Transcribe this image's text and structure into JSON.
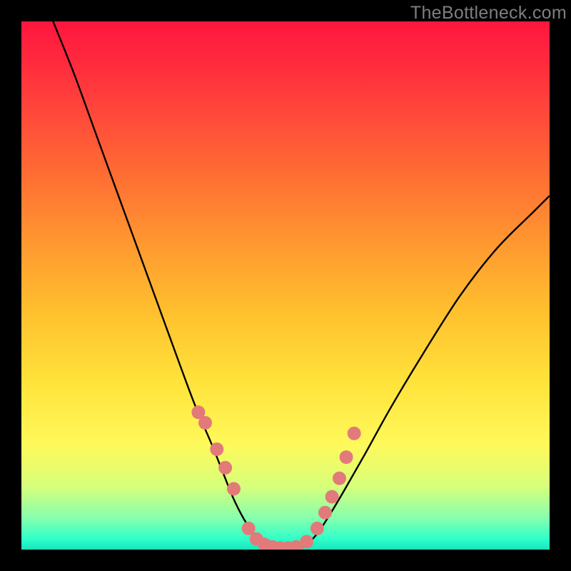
{
  "watermark": "TheBottleneck.com",
  "colors": {
    "frame": "#000000",
    "curve": "#000000",
    "marker_fill": "#e27a7a",
    "marker_stroke": "#c96060",
    "gradient_top": "#ff163e",
    "gradient_bottom": "#19e3bd"
  },
  "chart_data": {
    "type": "line",
    "title": "",
    "xlabel": "",
    "ylabel": "",
    "xlim": [
      0,
      100
    ],
    "ylim": [
      0,
      100
    ],
    "grid": false,
    "legend": false,
    "series": [
      {
        "name": "bottleneck-curve",
        "x": [
          6,
          10,
          14,
          18,
          22,
          26,
          30,
          33,
          36,
          38,
          40,
          42,
          44,
          46,
          48,
          50,
          52,
          54,
          56,
          58,
          61,
          65,
          70,
          76,
          83,
          90,
          97,
          100
        ],
        "y": [
          100,
          90,
          79,
          68,
          57,
          46,
          35,
          27,
          20,
          15,
          10,
          6,
          3,
          1,
          0,
          0,
          0,
          1,
          3,
          6,
          11,
          18,
          27,
          37,
          48,
          57,
          64,
          67
        ]
      }
    ],
    "markers": {
      "name": "highlighted-points",
      "x": [
        33.5,
        34.8,
        37.0,
        38.6,
        40.2,
        43.0,
        44.5,
        46.0,
        47.5,
        49.0,
        50.5,
        52.0,
        54.0,
        56.0,
        57.5,
        58.8,
        60.2,
        61.5,
        63.0
      ],
      "y": [
        26.0,
        24.0,
        19.0,
        15.5,
        11.5,
        4.0,
        2.0,
        1.0,
        0.5,
        0.3,
        0.3,
        0.5,
        1.5,
        4.0,
        7.0,
        10.0,
        13.5,
        17.5,
        22.0
      ]
    }
  }
}
